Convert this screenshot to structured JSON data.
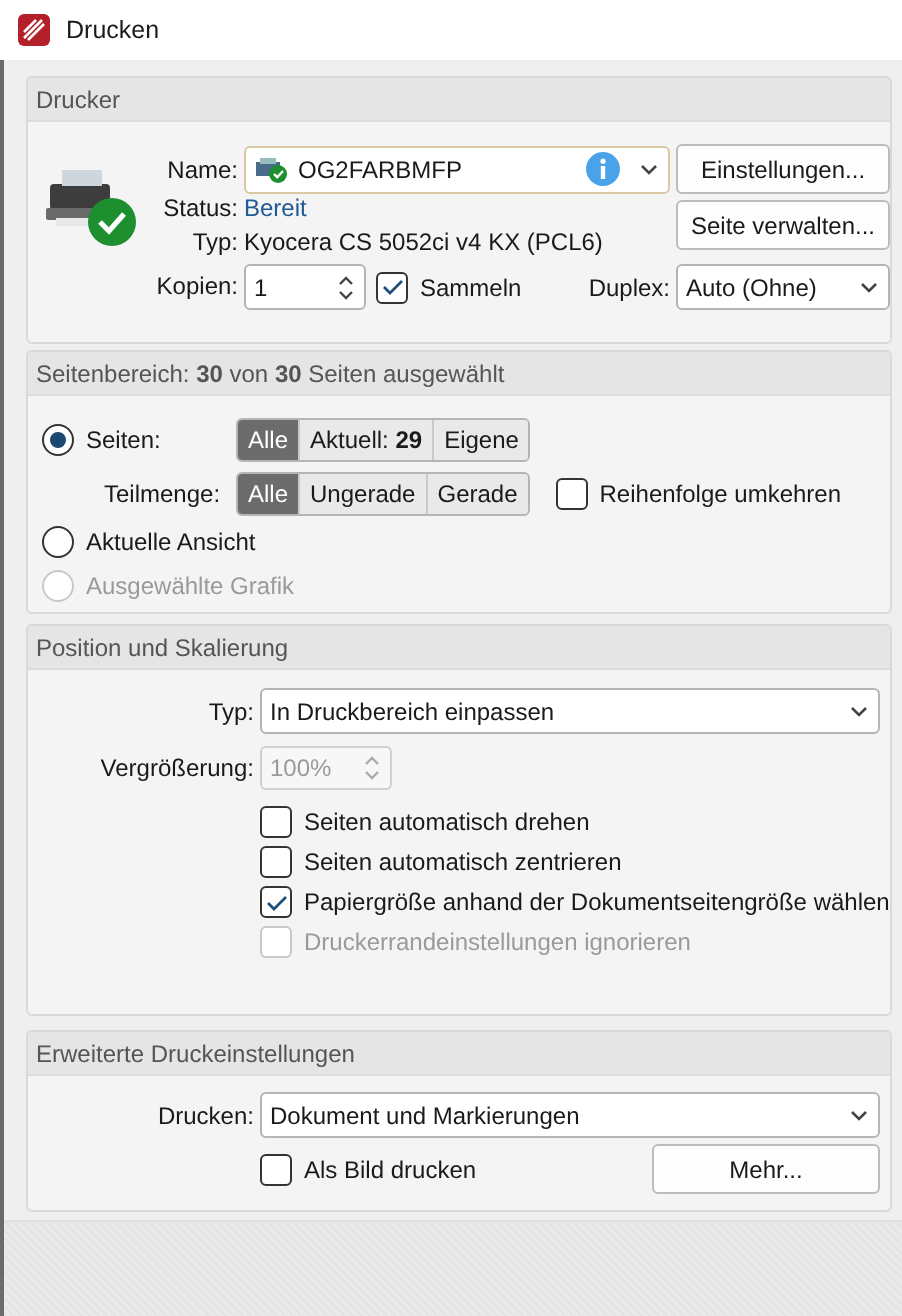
{
  "window": {
    "title": "Drucken"
  },
  "printer": {
    "title": "Drucker",
    "name_label": "Name:",
    "name": "OG2FARBMFP",
    "status_label": "Status:",
    "status": "Bereit",
    "type_label": "Typ:",
    "type": "Kyocera CS 5052ci v4 KX (PCL6)",
    "copies_label": "Kopien:",
    "copies": "1",
    "collate": {
      "label": "Sammeln",
      "checked": true,
      "disabled": false
    },
    "duplex_label": "Duplex:",
    "duplex": "Auto (Ohne)",
    "buttons": [
      "Einstellungen...",
      "Seite verwalten..."
    ]
  },
  "page_range": {
    "title": "Seitenbereich: **30** von **30** Seiten ausgewählt",
    "options": [
      {
        "label": "Seiten:",
        "selected": true,
        "disabled": false
      },
      {
        "label": "Aktuelle Ansicht",
        "selected": false,
        "disabled": false
      },
      {
        "label": "Ausgewählte Grafik",
        "selected": false,
        "disabled": true
      }
    ],
    "pages_segments": [
      {
        "label": "Alle",
        "selected": true
      },
      {
        "label": "Aktuell: **29**",
        "selected": false
      },
      {
        "label": "Eigene",
        "selected": false
      }
    ],
    "subset_label": "Teilmenge:",
    "subset_segments": [
      {
        "label": "Alle",
        "selected": true
      },
      {
        "label": "Ungerade",
        "selected": false
      },
      {
        "label": "Gerade",
        "selected": false
      }
    ],
    "reverse": {
      "label": "Reihenfolge umkehren",
      "checked": false,
      "disabled": false
    }
  },
  "scaling": {
    "title": "Position und Skalierung",
    "type_label": "Typ:",
    "type": "In Druckbereich einpassen",
    "zoom_label": "Vergrößerung:",
    "zoom": "100%",
    "zoom_disabled": true,
    "options": [
      {
        "label": "Seiten automatisch drehen",
        "checked": false,
        "disabled": false
      },
      {
        "label": "Seiten automatisch zentrieren",
        "checked": false,
        "disabled": false
      },
      {
        "label": "Papiergröße anhand der Dokumentseitengröße wählen",
        "checked": true,
        "disabled": false
      },
      {
        "label": "Druckerrandeinstellungen ignorieren",
        "checked": false,
        "disabled": true
      }
    ]
  },
  "advanced": {
    "title": "Erweiterte Druckeinstellungen",
    "print_label": "Drucken:",
    "print": "Dokument und Markierungen",
    "as_image": {
      "label": "Als Bild drucken",
      "checked": false,
      "disabled": false
    },
    "more_button": "Mehr..."
  }
}
